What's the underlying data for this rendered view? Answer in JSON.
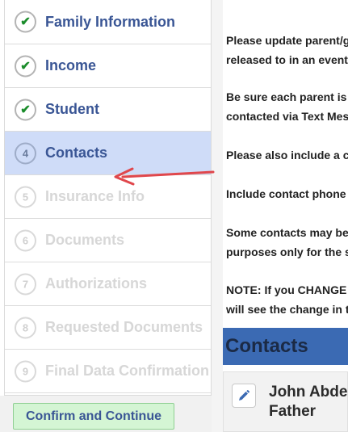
{
  "sidebar": {
    "steps": [
      {
        "marker": "",
        "label": "Family Information",
        "state": "done"
      },
      {
        "marker": "",
        "label": "Income",
        "state": "done"
      },
      {
        "marker": "",
        "label": "Student",
        "state": "done"
      },
      {
        "marker": "4",
        "label": "Contacts",
        "state": "active"
      },
      {
        "marker": "5",
        "label": "Insurance Info",
        "state": "disabled"
      },
      {
        "marker": "6",
        "label": "Documents",
        "state": "disabled"
      },
      {
        "marker": "7",
        "label": "Authorizations",
        "state": "disabled"
      },
      {
        "marker": "8",
        "label": "Requested Documents",
        "state": "disabled"
      },
      {
        "marker": "9",
        "label": "Final Data Confirmation",
        "state": "disabled"
      }
    ],
    "confirm_label": "Confirm and Continue"
  },
  "main": {
    "paragraphs": [
      {
        "line1": "Please update parent/g",
        "line2": "released to in an event"
      },
      {
        "line1": "Be sure each parent is l",
        "line2": "contacted via Text Mes"
      },
      {
        "line1": "Please also include a co",
        "line2": ""
      },
      {
        "line1": "Include contact phone n",
        "line2": ""
      },
      {
        "line1": "Some contacts may be",
        "line2": "purposes only for the s"
      },
      {
        "line1": "NOTE: If you CHANGE",
        "line2": "will see the change in t"
      }
    ],
    "contacts_heading": "Contacts",
    "contact_card": {
      "name": "John Abdel",
      "relation": "Father"
    }
  },
  "colors": {
    "accent_blue": "#3a5695",
    "active_step_bg": "#cfdcf8",
    "check_green": "#1a8c2a",
    "confirm_bg": "#d4f5d4",
    "contacts_header_bg": "#3b6ab3",
    "annotation_arrow": "#e0474c"
  },
  "icons": {
    "done_marker": "check-icon",
    "edit": "pencil-icon",
    "annotation": "red-arrow-pointer"
  }
}
